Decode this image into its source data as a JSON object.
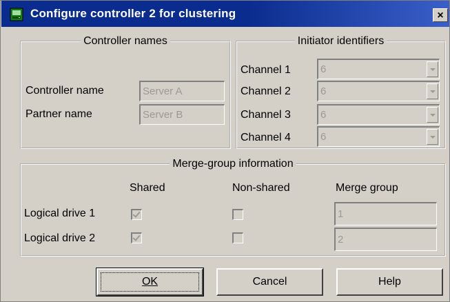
{
  "window": {
    "title": "Configure controller 2 for clustering",
    "close_label": "×"
  },
  "controller_names": {
    "legend": "Controller names",
    "controller_label": "Controller name",
    "controller_value": "Server A",
    "partner_label": "Partner name",
    "partner_value": "Server B"
  },
  "initiator": {
    "legend": "Initiator identifiers",
    "channels": [
      {
        "label": "Channel 1",
        "value": "6"
      },
      {
        "label": "Channel 2",
        "value": "6"
      },
      {
        "label": "Channel 3",
        "value": "6"
      },
      {
        "label": "Channel 4",
        "value": "6"
      }
    ]
  },
  "merge": {
    "legend": "Merge-group information",
    "col_shared": "Shared",
    "col_nonshared": "Non-shared",
    "col_merge": "Merge group",
    "rows": [
      {
        "label": "Logical drive 1",
        "shared": true,
        "nonshared": false,
        "group": "1"
      },
      {
        "label": "Logical drive 2",
        "shared": true,
        "nonshared": false,
        "group": "2"
      }
    ]
  },
  "buttons": {
    "ok": "OK",
    "cancel": "Cancel",
    "help": "Help"
  },
  "colors": {
    "titlebar": "#0a2c8e",
    "face": "#d4d0c8",
    "disabled_text": "#9c9a94"
  }
}
